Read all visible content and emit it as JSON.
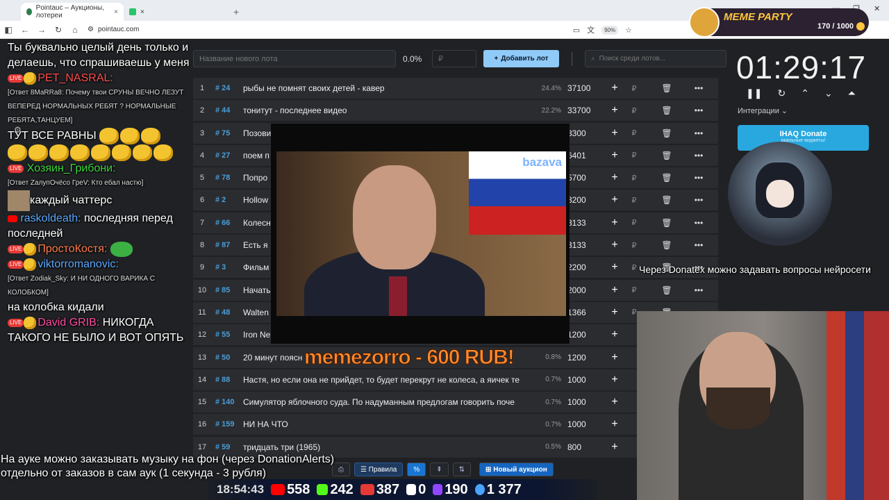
{
  "browser": {
    "tab1_title": "Pointauc – Аукционы, лотереи",
    "tab_close": "×",
    "new_tab": "+",
    "url": "pointauc.com",
    "zoom": "90%",
    "win_min": "—",
    "win_max": "❐",
    "win_close": "✕",
    "win_chevron": "⌄"
  },
  "toolbar": {
    "lot_placeholder": "Название нового лота",
    "percent": "0.0%",
    "rub_placeholder": "₽",
    "add_button": "Добавить лот",
    "search_placeholder": "Поиск среди лотов..."
  },
  "lots": [
    {
      "n": "1",
      "id": "# 24",
      "name": "рыбы не помнят своих детей - кавер",
      "pct": "24.4%",
      "amount": "37100",
      "plus": "+",
      "rub": "₽",
      "del": "🗑",
      "more": "•••"
    },
    {
      "n": "2",
      "id": "# 44",
      "name": "тонитут - последнее видео",
      "pct": "22.2%",
      "amount": "33700",
      "plus": "+",
      "rub": "₽",
      "del": "🗑",
      "more": "•••"
    },
    {
      "n": "3",
      "id": "# 75",
      "name": "Позови",
      "pct": "",
      "amount": "8300",
      "plus": "+",
      "rub": "₽",
      "del": "🗑",
      "more": "•••"
    },
    {
      "n": "4",
      "id": "# 27",
      "name": "поем п",
      "pct": "",
      "amount": "6401",
      "plus": "+",
      "rub": "₽",
      "del": "🗑",
      "more": "•••"
    },
    {
      "n": "5",
      "id": "# 78",
      "name": "Попро",
      "pct": "",
      "amount": "5700",
      "plus": "+",
      "rub": "₽",
      "del": "🗑",
      "more": "•••"
    },
    {
      "n": "6",
      "id": "# 2",
      "name": "Hollow",
      "pct": "",
      "amount": "3200",
      "plus": "+",
      "rub": "₽",
      "del": "🗑",
      "more": "•••"
    },
    {
      "n": "7",
      "id": "# 66",
      "name": "Колесн",
      "pct": "",
      "amount": "3133",
      "plus": "+",
      "rub": "₽",
      "del": "🗑",
      "more": "•••"
    },
    {
      "n": "8",
      "id": "# 87",
      "name": "Есть я",
      "pct": "",
      "amount": "3133",
      "plus": "+",
      "rub": "₽",
      "del": "🗑",
      "more": "•••"
    },
    {
      "n": "9",
      "id": "# 3",
      "name": "Фильм",
      "pct": "",
      "amount": "2200",
      "plus": "+",
      "rub": "₽",
      "del": "🗑",
      "more": "•••"
    },
    {
      "n": "10",
      "id": "# 85",
      "name": "Начать",
      "pct": "",
      "amount": "2000",
      "plus": "+",
      "rub": "₽",
      "del": "🗑",
      "more": "•••"
    },
    {
      "n": "11",
      "id": "# 48",
      "name": "Walten",
      "pct": "",
      "amount": "1366",
      "plus": "+",
      "rub": "₽",
      "del": "🗑",
      "more": "•••"
    },
    {
      "n": "12",
      "id": "# 55",
      "name": "Iron Ne",
      "pct": "",
      "amount": "1200",
      "plus": "+",
      "rub": "",
      "del": "",
      "more": ""
    },
    {
      "n": "13",
      "id": "# 50",
      "name": "20 минут поясн",
      "pct": "0.8%",
      "amount": "1200",
      "plus": "+",
      "rub": "",
      "del": "",
      "more": ""
    },
    {
      "n": "14",
      "id": "# 88",
      "name": "Настя, но если она не прийдет, то будет перекрут не колеса, а яичек те",
      "pct": "0.7%",
      "amount": "1000",
      "plus": "+",
      "rub": "",
      "del": "",
      "more": ""
    },
    {
      "n": "15",
      "id": "# 140",
      "name": "Симулятор яблочного суда. По надуманным предлогам говорить поче",
      "pct": "0.7%",
      "amount": "1000",
      "plus": "+",
      "rub": "",
      "del": "",
      "more": ""
    },
    {
      "n": "16",
      "id": "# 159",
      "name": "НИ НА ЧТО",
      "pct": "0.7%",
      "amount": "1000",
      "plus": "+",
      "rub": "",
      "del": "",
      "more": ""
    },
    {
      "n": "17",
      "id": "# 59",
      "name": "тридцать три (1965)",
      "pct": "0.5%",
      "amount": "800",
      "plus": "+",
      "rub": "",
      "del": "",
      "more": ""
    }
  ],
  "bottom": {
    "rules": "Правила",
    "percent_icon": "%",
    "new_auction": "Новый аукцион"
  },
  "timer": {
    "value": "01:29:17",
    "pause": "❚❚",
    "reset": "↻",
    "up": "⌃",
    "down": "⌄",
    "top": "⏶",
    "integrations": "Интеграции ⌄"
  },
  "donate": {
    "label": "IHAQ Donate",
    "sub": "ркальные виджеты!"
  },
  "meme_party": {
    "title": "MEME PARTY",
    "count": "170 / 1000"
  },
  "chat": {
    "l1": "Ты буквально целый день только и делаешь, что спрашиваешь у меня",
    "u1": "PET_NASRAL:",
    "r1": "[Ответ 8MaRRa8: Почему твои СРУНЫ ВЕЧНО ЛЕЗУТ ВЕПЕРЕД НОРМАЛЬНЫХ РЕБЯТ ? НОРМАЛЬНЫЕ РЕБЯТА,ТАНЦУЕМ]",
    "m1": "ТУТ ВСЕ РАВНЫ",
    "u2": "Хозяин_Грибони:",
    "r2": "[Ответ ZалупОчёсо ГреV: Кто ебал настю]",
    "m2": "каждый чаттерс",
    "u3": "raskoldeath:",
    "m3": "последняя перед последней",
    "u4": "ПростоКостя:",
    "u5": "viktorromanovic:",
    "r5": "[Ответ Zodiak_Sky: И НИ ОДНОГО ВАРИКА С КОЛОБКОМ]",
    "m5": "на колобка кидали",
    "u6": "David GRIB:",
    "m6": "НИКОГДА ТАКОГО НЕ БЫЛО И ВОТ ОПЯТЬ",
    "live": "LIVE"
  },
  "video": {
    "watermark": "bazava"
  },
  "alert_text": "memezorro - 600 RUB!",
  "caption_right": "Через Donatex можно задавать вопросы нейросети",
  "caption_bottom_1": "На ауке можно заказывать музыку на фон (через DonationAlerts)",
  "caption_bottom_2": "отдельно от заказов в сам аук (1 секунда - 3 рубля)",
  "stats": {
    "clock": "18:54:43",
    "youtube": "558",
    "kick": "242",
    "vk": "387",
    "rutube": "0",
    "twitch": "190",
    "total": "1 377"
  }
}
